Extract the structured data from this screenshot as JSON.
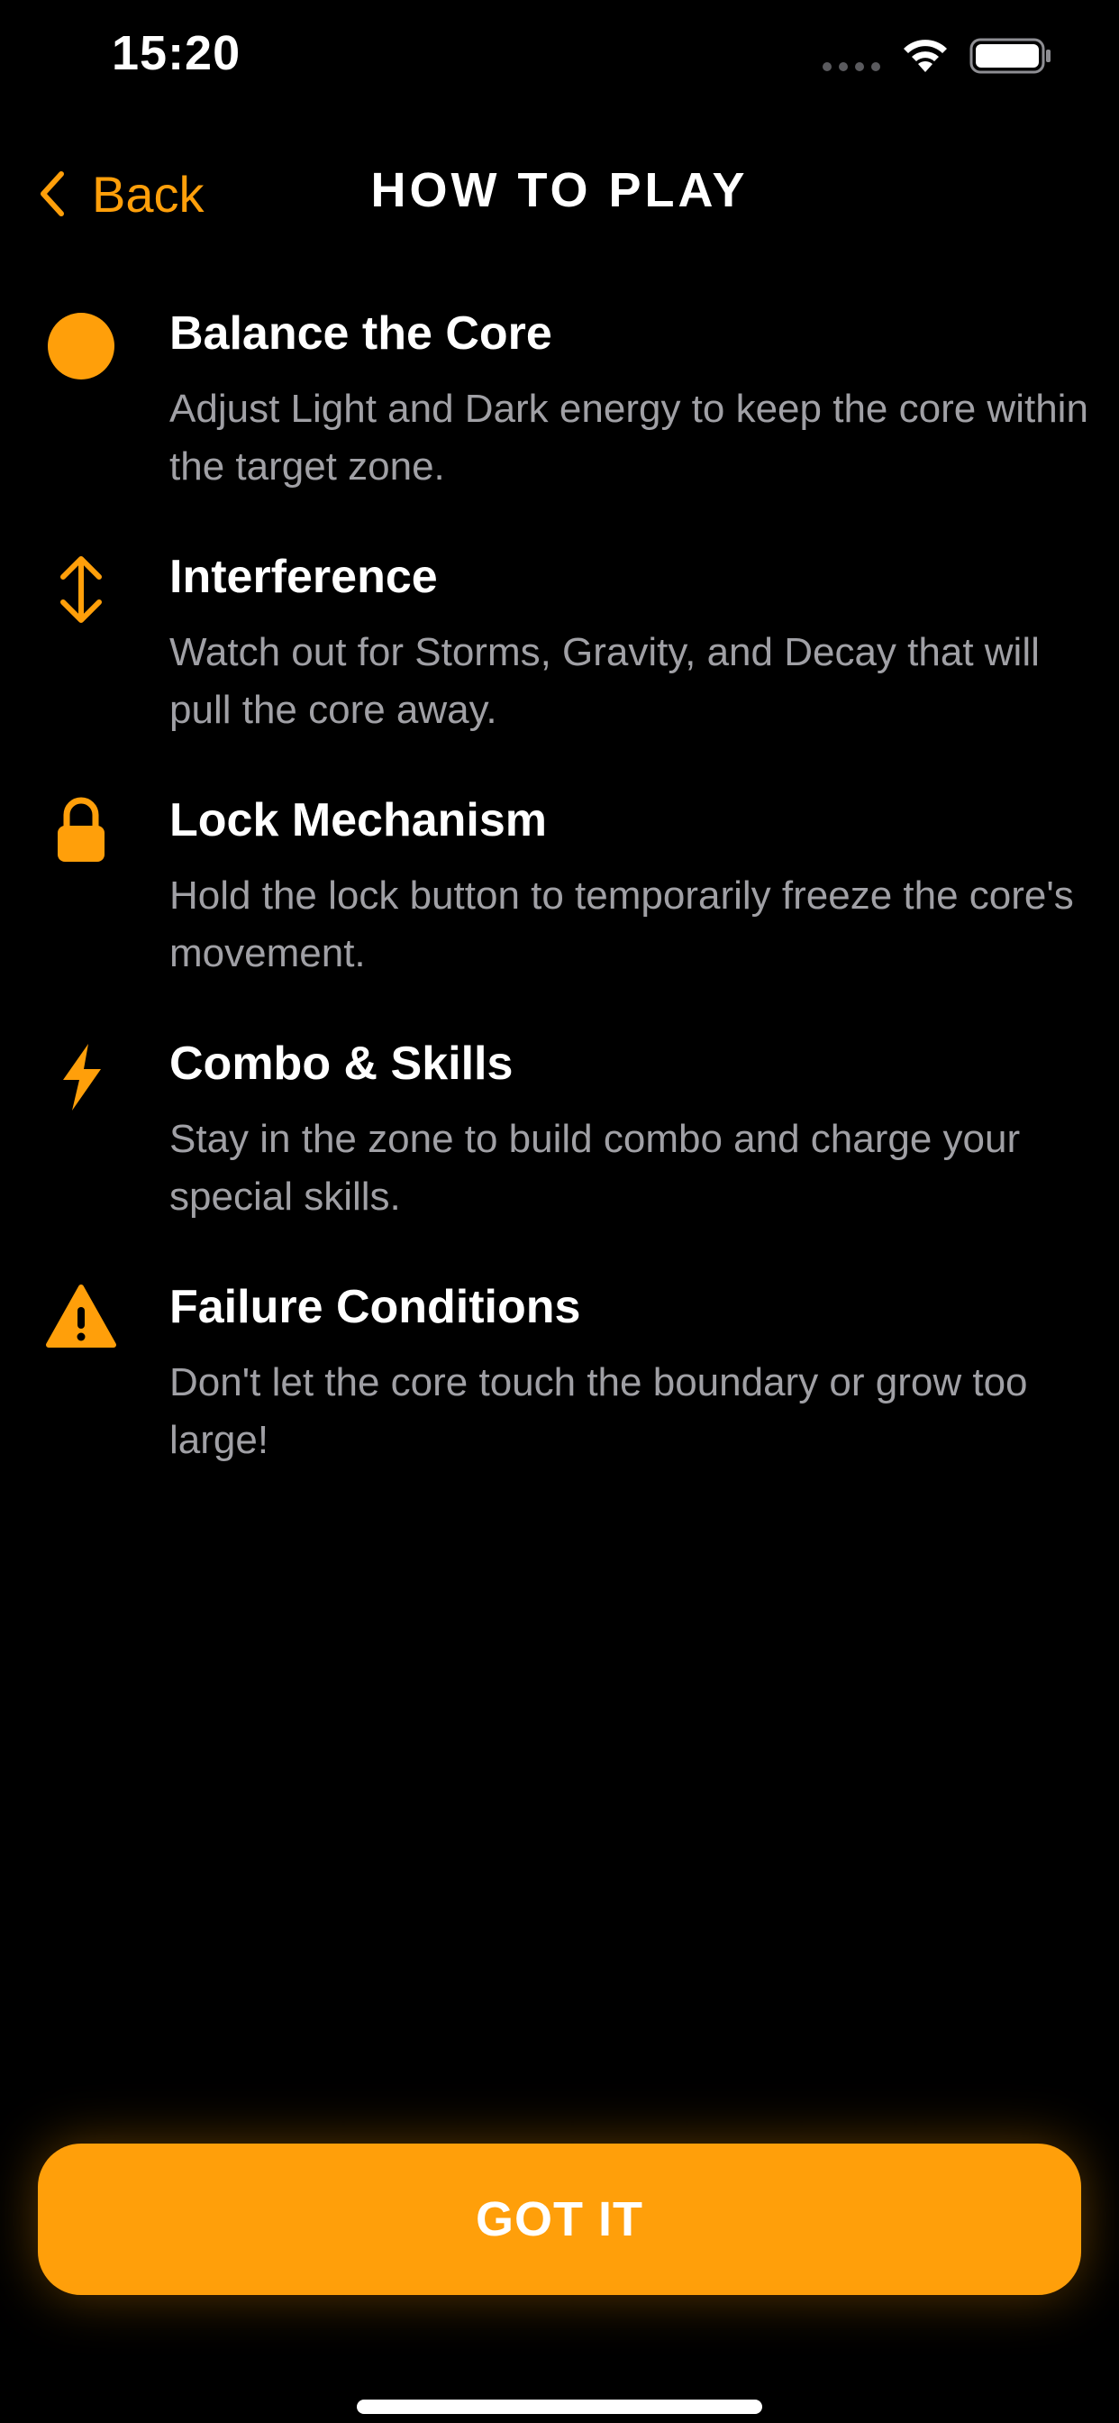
{
  "status_bar": {
    "time": "15:20"
  },
  "nav": {
    "back_label": "Back",
    "title": "HOW TO PLAY"
  },
  "rules": [
    {
      "icon": "circle-icon",
      "title": "Balance the Core",
      "description": "Adjust Light and Dark energy to keep the core within the target zone."
    },
    {
      "icon": "arrow-up-down-icon",
      "title": "Interference",
      "description": "Watch out for Storms, Gravity, and Decay that will pull the core away."
    },
    {
      "icon": "lock-icon",
      "title": "Lock Mechanism",
      "description": "Hold the lock button to temporarily freeze the core's movement."
    },
    {
      "icon": "bolt-icon",
      "title": "Combo & Skills",
      "description": "Stay in the zone to build combo and charge your special skills."
    },
    {
      "icon": "warning-icon",
      "title": "Failure Conditions",
      "description": "Don't let the core touch the boundary or grow too large!"
    }
  ],
  "primary_button": {
    "label": "GOT IT"
  },
  "colors": {
    "accent": "#ff9f0a",
    "background": "#000000",
    "text_primary": "#ffffff",
    "text_secondary": "#a0a0a5"
  }
}
